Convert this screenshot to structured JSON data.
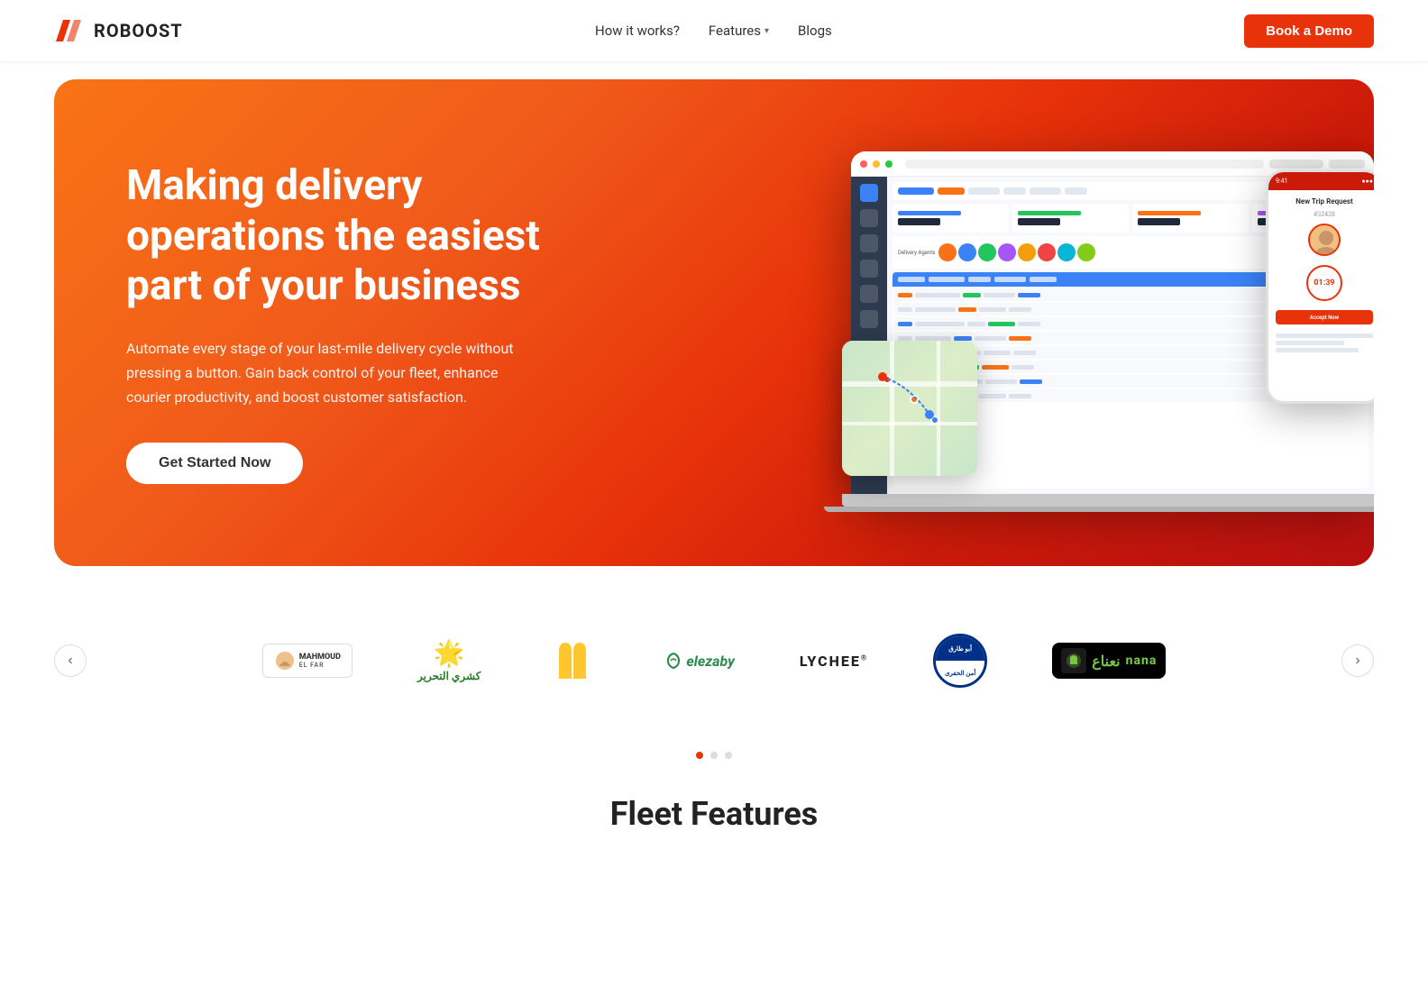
{
  "nav": {
    "logo_text": "ROBOOST",
    "links": [
      {
        "label": "How it works?",
        "has_dropdown": false
      },
      {
        "label": "Features",
        "has_dropdown": true
      },
      {
        "label": "Blogs",
        "has_dropdown": false
      }
    ],
    "book_demo_label": "Book a Demo"
  },
  "hero": {
    "title": "Making delivery operations the easiest part of your business",
    "subtitle": "Automate every stage of your last-mile delivery cycle without pressing a button. Gain back control of your fleet, enhance courier productivity, and boost customer satisfaction.",
    "cta_label": "Get Started Now"
  },
  "logos": {
    "prev_label": "‹",
    "next_label": "›",
    "items": [
      {
        "name": "Mahmoud Elfar",
        "type": "mahmoud"
      },
      {
        "name": "Kashry Al-Tahrir",
        "type": "kashry"
      },
      {
        "name": "McDonald's",
        "type": "mcdonalds"
      },
      {
        "name": "Elezaby",
        "type": "elezaby"
      },
      {
        "name": "LYCHEE",
        "type": "lychee"
      },
      {
        "name": "Abu Tariq",
        "type": "abutariq"
      },
      {
        "name": "nana",
        "type": "nana"
      }
    ],
    "dots": [
      {
        "active": true
      },
      {
        "active": false
      },
      {
        "active": false
      }
    ]
  },
  "fleet": {
    "title": "Fleet Features"
  },
  "phone": {
    "order_title": "New Trip Request",
    "order_id": "#32428",
    "timer": "01:39",
    "btn_label": "Accept Now"
  }
}
